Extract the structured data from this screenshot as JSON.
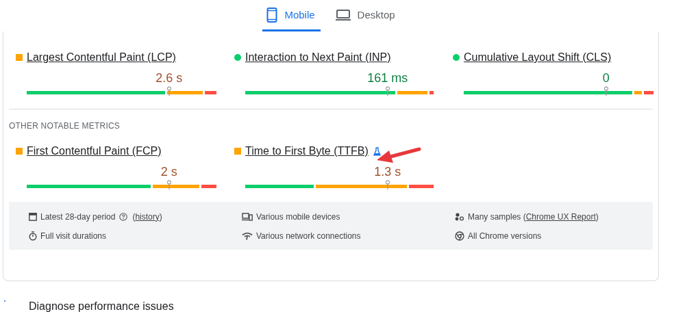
{
  "tabs": [
    {
      "label": "Mobile",
      "selected": true
    },
    {
      "label": "Desktop",
      "selected": false
    }
  ],
  "core_metrics": [
    {
      "title": "Largest Contentful Paint (LCP)",
      "kind": "needs_improvement",
      "value": "2.6 s"
    },
    {
      "title": "Interaction to Next Paint (INP)",
      "kind": "good",
      "value": "161 ms"
    },
    {
      "title": "Cumulative Layout Shift (CLS)",
      "kind": "good",
      "value": "0"
    }
  ],
  "other_heading": "OTHER NOTABLE METRICS",
  "other_metrics": [
    {
      "title": "First Contentful Paint (FCP)",
      "kind": "needs_improvement",
      "value": "2 s",
      "experimental": false
    },
    {
      "title": "Time to First Byte (TTFB)",
      "kind": "needs_improvement",
      "value": "1.3 s",
      "experimental": true
    }
  ],
  "footer_items": [
    {
      "segments": [
        {
          "kind": "text",
          "text": "Latest 28-day period"
        },
        {
          "kind": "help"
        },
        {
          "kind": "text",
          "text": "("
        },
        {
          "kind": "link",
          "text": "history"
        },
        {
          "kind": "text",
          "text": ")"
        }
      ]
    },
    {
      "segments": [
        {
          "kind": "text",
          "text": "Various mobile devices"
        }
      ]
    },
    {
      "segments": [
        {
          "kind": "text",
          "text": "Many samples ("
        },
        {
          "kind": "link",
          "text": "Chrome UX Report"
        },
        {
          "kind": "text",
          "text": ")"
        }
      ]
    },
    {
      "segments": [
        {
          "kind": "text",
          "text": "Full visit durations"
        }
      ]
    },
    {
      "segments": [
        {
          "kind": "text",
          "text": "Various network connections"
        }
      ]
    },
    {
      "segments": [
        {
          "kind": "text",
          "text": "All Chrome versions"
        }
      ]
    }
  ],
  "next_section": "Diagnose performance issues"
}
